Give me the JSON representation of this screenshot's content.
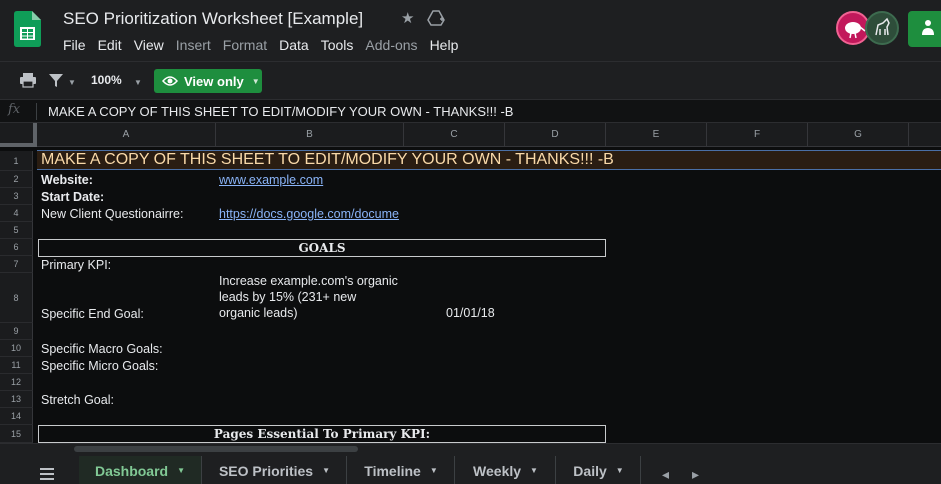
{
  "header": {
    "title": "SEO Prioritization Worksheet [Example]",
    "menu": [
      "File",
      "Edit",
      "View",
      "Insert",
      "Format",
      "Data",
      "Tools",
      "Add-ons",
      "Help"
    ],
    "disabled_menu": [
      "Insert",
      "Format",
      "Add-ons"
    ],
    "icons": [
      "sheets-logo-icon",
      "star-icon",
      "drive-move-icon",
      "share-icon"
    ]
  },
  "toolbar": {
    "zoom": "100%",
    "view_only_label": "View only"
  },
  "formula_bar": {
    "fx": "fx",
    "content": "MAKE A COPY OF THIS SHEET TO EDIT/MODIFY YOUR OWN - THANKS!!! -B"
  },
  "grid": {
    "columns": [
      "A",
      "B",
      "C",
      "D",
      "E",
      "F",
      "G"
    ],
    "rows": [
      "1",
      "2",
      "3",
      "4",
      "5",
      "6",
      "7",
      "8",
      "9",
      "10",
      "11",
      "12",
      "13",
      "14",
      "15"
    ],
    "banner": "MAKE A COPY OF THIS SHEET TO EDIT/MODIFY YOUR OWN - THANKS!!! -B",
    "website_label": "Website:",
    "website_value": "www.example.com",
    "start_date_label": "Start Date:",
    "questionnaire_label": "New Client Questionairre:",
    "questionnaire_value": "https://docs.google.com/docume",
    "goals_header": "GOALS",
    "primary_kpi_label": "Primary KPI:",
    "goal_text_1": "Increase example.com's organic",
    "goal_text_2": "leads by 15% (231+ new",
    "goal_text_3": "organic leads)",
    "specific_end_goal_label": "Specific End Goal:",
    "end_goal_date": "01/01/18",
    "macro_goals_label": "Specific Macro Goals:",
    "micro_goals_label": "Specific Micro Goals:",
    "stretch_goal_label": "Stretch Goal:",
    "pages_essential_header": "Pages Essential To Primary KPI:"
  },
  "sheet_tabs": [
    {
      "label": "Dashboard",
      "active": true
    },
    {
      "label": "SEO Priorities",
      "active": false
    },
    {
      "label": "Timeline",
      "active": false
    },
    {
      "label": "Weekly",
      "active": false
    },
    {
      "label": "Daily",
      "active": false
    }
  ],
  "colors": {
    "accent_green": "#1e8e3e",
    "active_tab_text": "#81c995",
    "link": "#8ab4f8",
    "banner_text": "#f9d9a8"
  }
}
